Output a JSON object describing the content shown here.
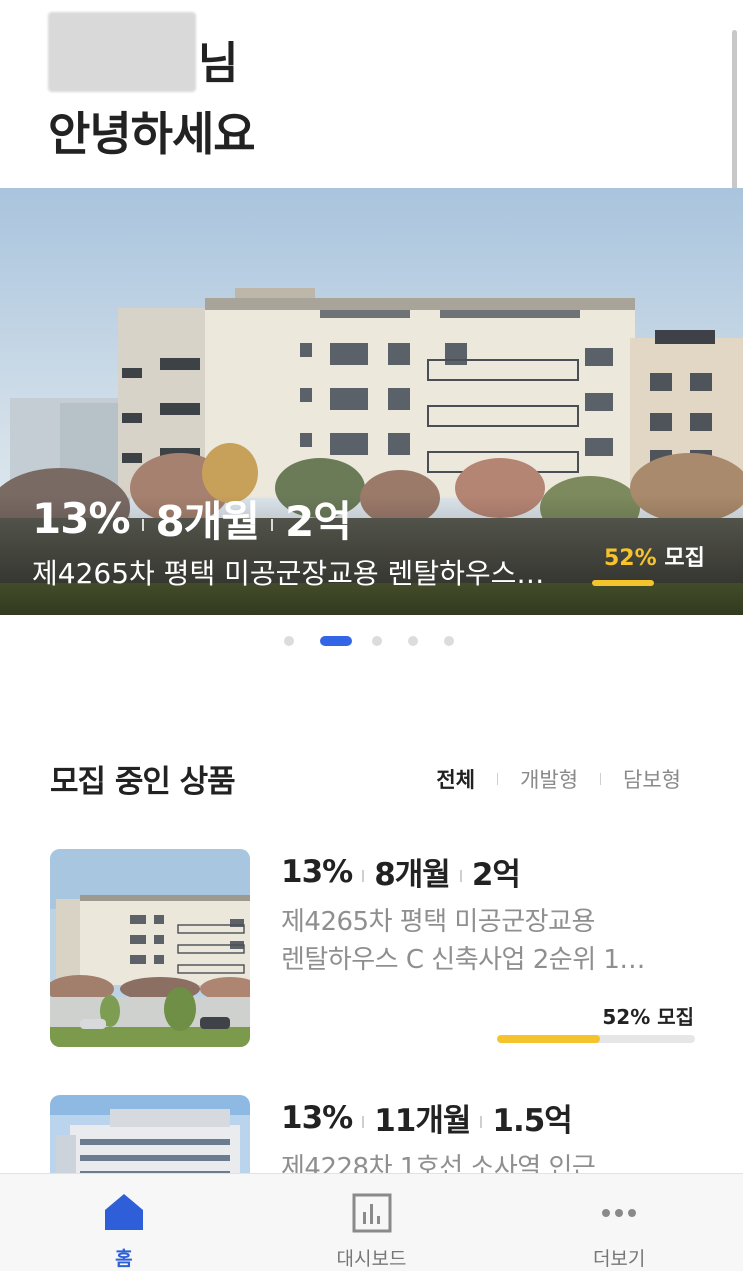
{
  "greeting": {
    "honorific": "님",
    "hello": "안녕하세요"
  },
  "banner": {
    "stats": [
      "13%",
      "8개월",
      "2억"
    ],
    "title": "제4265차 평택 미공군장교용 렌탈하우스…",
    "recruit_pct": "52%",
    "recruit_label": "모집",
    "progress": 0.52,
    "carousel_index": 1,
    "carousel_count": 5
  },
  "section": {
    "title": "모집 중인 상품",
    "filters": [
      "전체",
      "개발형",
      "담보형"
    ],
    "active_filter": "전체"
  },
  "products": [
    {
      "stats": [
        "13%",
        "8개월",
        "2억"
      ],
      "title_line1": "제4265차 평택 미공군장교용",
      "title_line2": "렌탈하우스 C 신축사업 2순위 1…",
      "recruit": "52% 모집",
      "progress": 0.52
    },
    {
      "stats": [
        "13%",
        "11개월",
        "1.5억"
      ],
      "title_line1": "제4228차 1호선 소사역 인근",
      "title_line2": ""
    }
  ],
  "nav": {
    "items": [
      {
        "label": "홈",
        "icon": "home-icon",
        "active": true
      },
      {
        "label": "대시보드",
        "icon": "dashboard-icon",
        "active": false
      },
      {
        "label": "더보기",
        "icon": "more-icon",
        "active": false
      }
    ]
  },
  "colors": {
    "accent_blue": "#3366e6",
    "progress_yellow": "#f5c32c"
  }
}
